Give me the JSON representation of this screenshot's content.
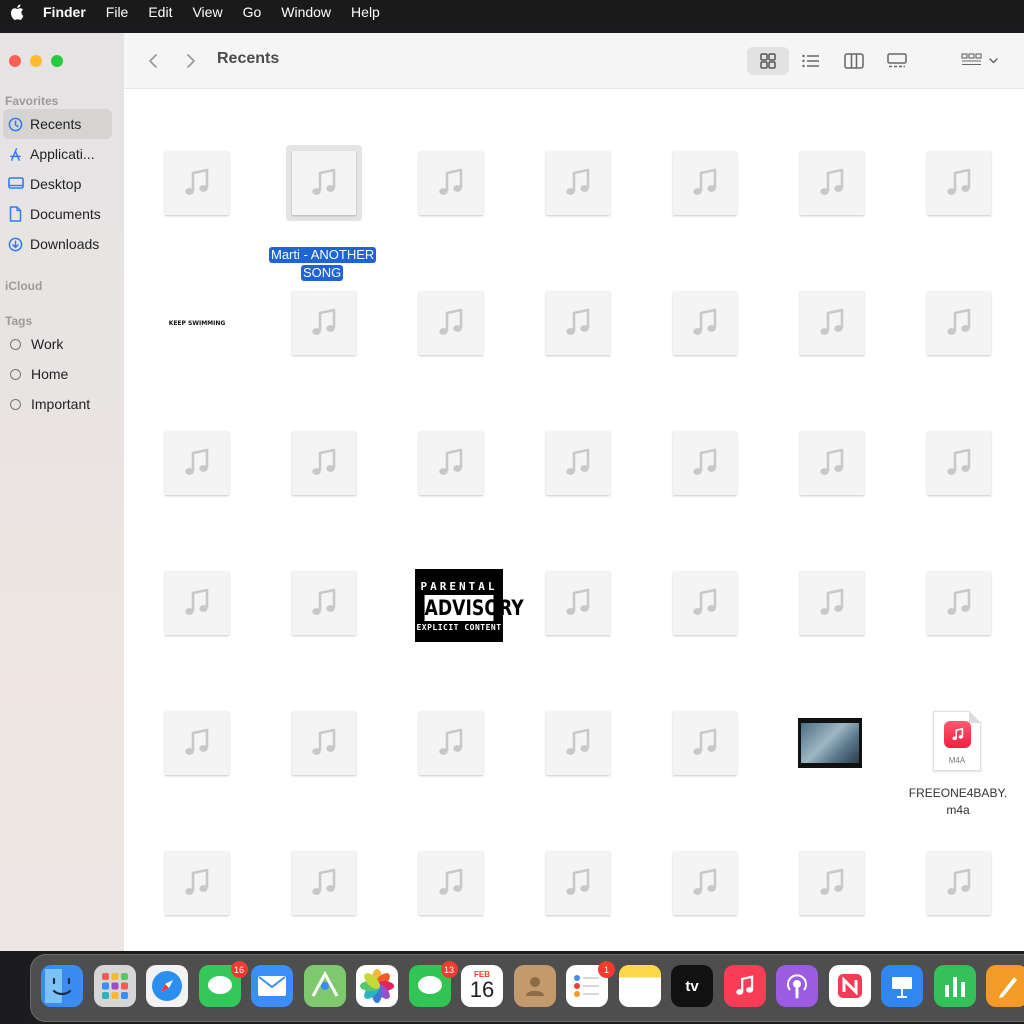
{
  "menubar": {
    "app_name": "Finder",
    "items": [
      "File",
      "Edit",
      "View",
      "Go",
      "Window",
      "Help"
    ]
  },
  "sidebar": {
    "favorites_header": "Favorites",
    "favorites": [
      {
        "label": "Recents",
        "icon": "clock-icon",
        "selected": true
      },
      {
        "label": "Applicati...",
        "icon": "applications-icon"
      },
      {
        "label": "Desktop",
        "icon": "desktop-icon"
      },
      {
        "label": "Documents",
        "icon": "document-icon"
      },
      {
        "label": "Downloads",
        "icon": "download-icon"
      }
    ],
    "icloud_header": "iCloud",
    "tags_header": "Tags",
    "tags": [
      {
        "label": "Work"
      },
      {
        "label": "Home"
      },
      {
        "label": "Important"
      }
    ]
  },
  "toolbar": {
    "title": "Recents",
    "views": [
      "icon-view-icon",
      "list-view-icon",
      "column-view-icon",
      "gallery-view-icon"
    ],
    "group_icon": "group-by-icon"
  },
  "files": {
    "selected_label_line1": "Marti - ANOTHER",
    "selected_label_line2": "SONG",
    "keep_swimming_text": "KEEP SWIMMING",
    "advisory_top": "PARENTAL",
    "advisory_mid": "ADVISORY",
    "advisory_bottom": "EXPLICIT CONTENT",
    "m4a_badge": "M4A",
    "m4a_name_line1": "FREEONE4BABY.",
    "m4a_name_line2": "m4a"
  },
  "dock": {
    "apps": [
      {
        "name": "Finder",
        "icon": "finder-icon",
        "color": "#3b8cf0"
      },
      {
        "name": "Launchpad",
        "icon": "launchpad-icon",
        "color": "#d6d6d6"
      },
      {
        "name": "Safari",
        "icon": "safari-icon",
        "color": "#f2f2f2"
      },
      {
        "name": "Messages",
        "icon": "messages-icon",
        "color": "#34c759",
        "badge": "16"
      },
      {
        "name": "Mail",
        "icon": "mail-icon",
        "color": "#3a8ef5"
      },
      {
        "name": "Maps",
        "icon": "maps-icon",
        "color": "#7ec86e"
      },
      {
        "name": "Photos",
        "icon": "photos-icon",
        "color": "#ffffff"
      },
      {
        "name": "FaceTime",
        "icon": "facetime-icon",
        "color": "#31c553",
        "badge": "13"
      },
      {
        "name": "Calendar",
        "icon": "calendar-icon",
        "color": "#ffffff",
        "month": "FEB",
        "day": "16"
      },
      {
        "name": "Contacts",
        "icon": "contacts-icon",
        "color": "#c39a6b"
      },
      {
        "name": "Reminders",
        "icon": "reminders-icon",
        "color": "#ffffff",
        "badge": "1"
      },
      {
        "name": "Notes",
        "icon": "notes-icon",
        "color": "#fcd84a"
      },
      {
        "name": "TV",
        "icon": "tv-icon",
        "color": "#111111",
        "label": "tv"
      },
      {
        "name": "Music",
        "icon": "music-icon",
        "color": "#fa3c55"
      },
      {
        "name": "Podcasts",
        "icon": "podcasts-icon",
        "color": "#9b5ce1"
      },
      {
        "name": "News",
        "icon": "news-icon",
        "color": "#ffffff"
      },
      {
        "name": "Keynote",
        "icon": "keynote-icon",
        "color": "#2f87ef"
      },
      {
        "name": "Numbers",
        "icon": "numbers-icon",
        "color": "#35c15a"
      },
      {
        "name": "Pages",
        "icon": "pages-icon",
        "color": "#f49a26"
      }
    ]
  }
}
